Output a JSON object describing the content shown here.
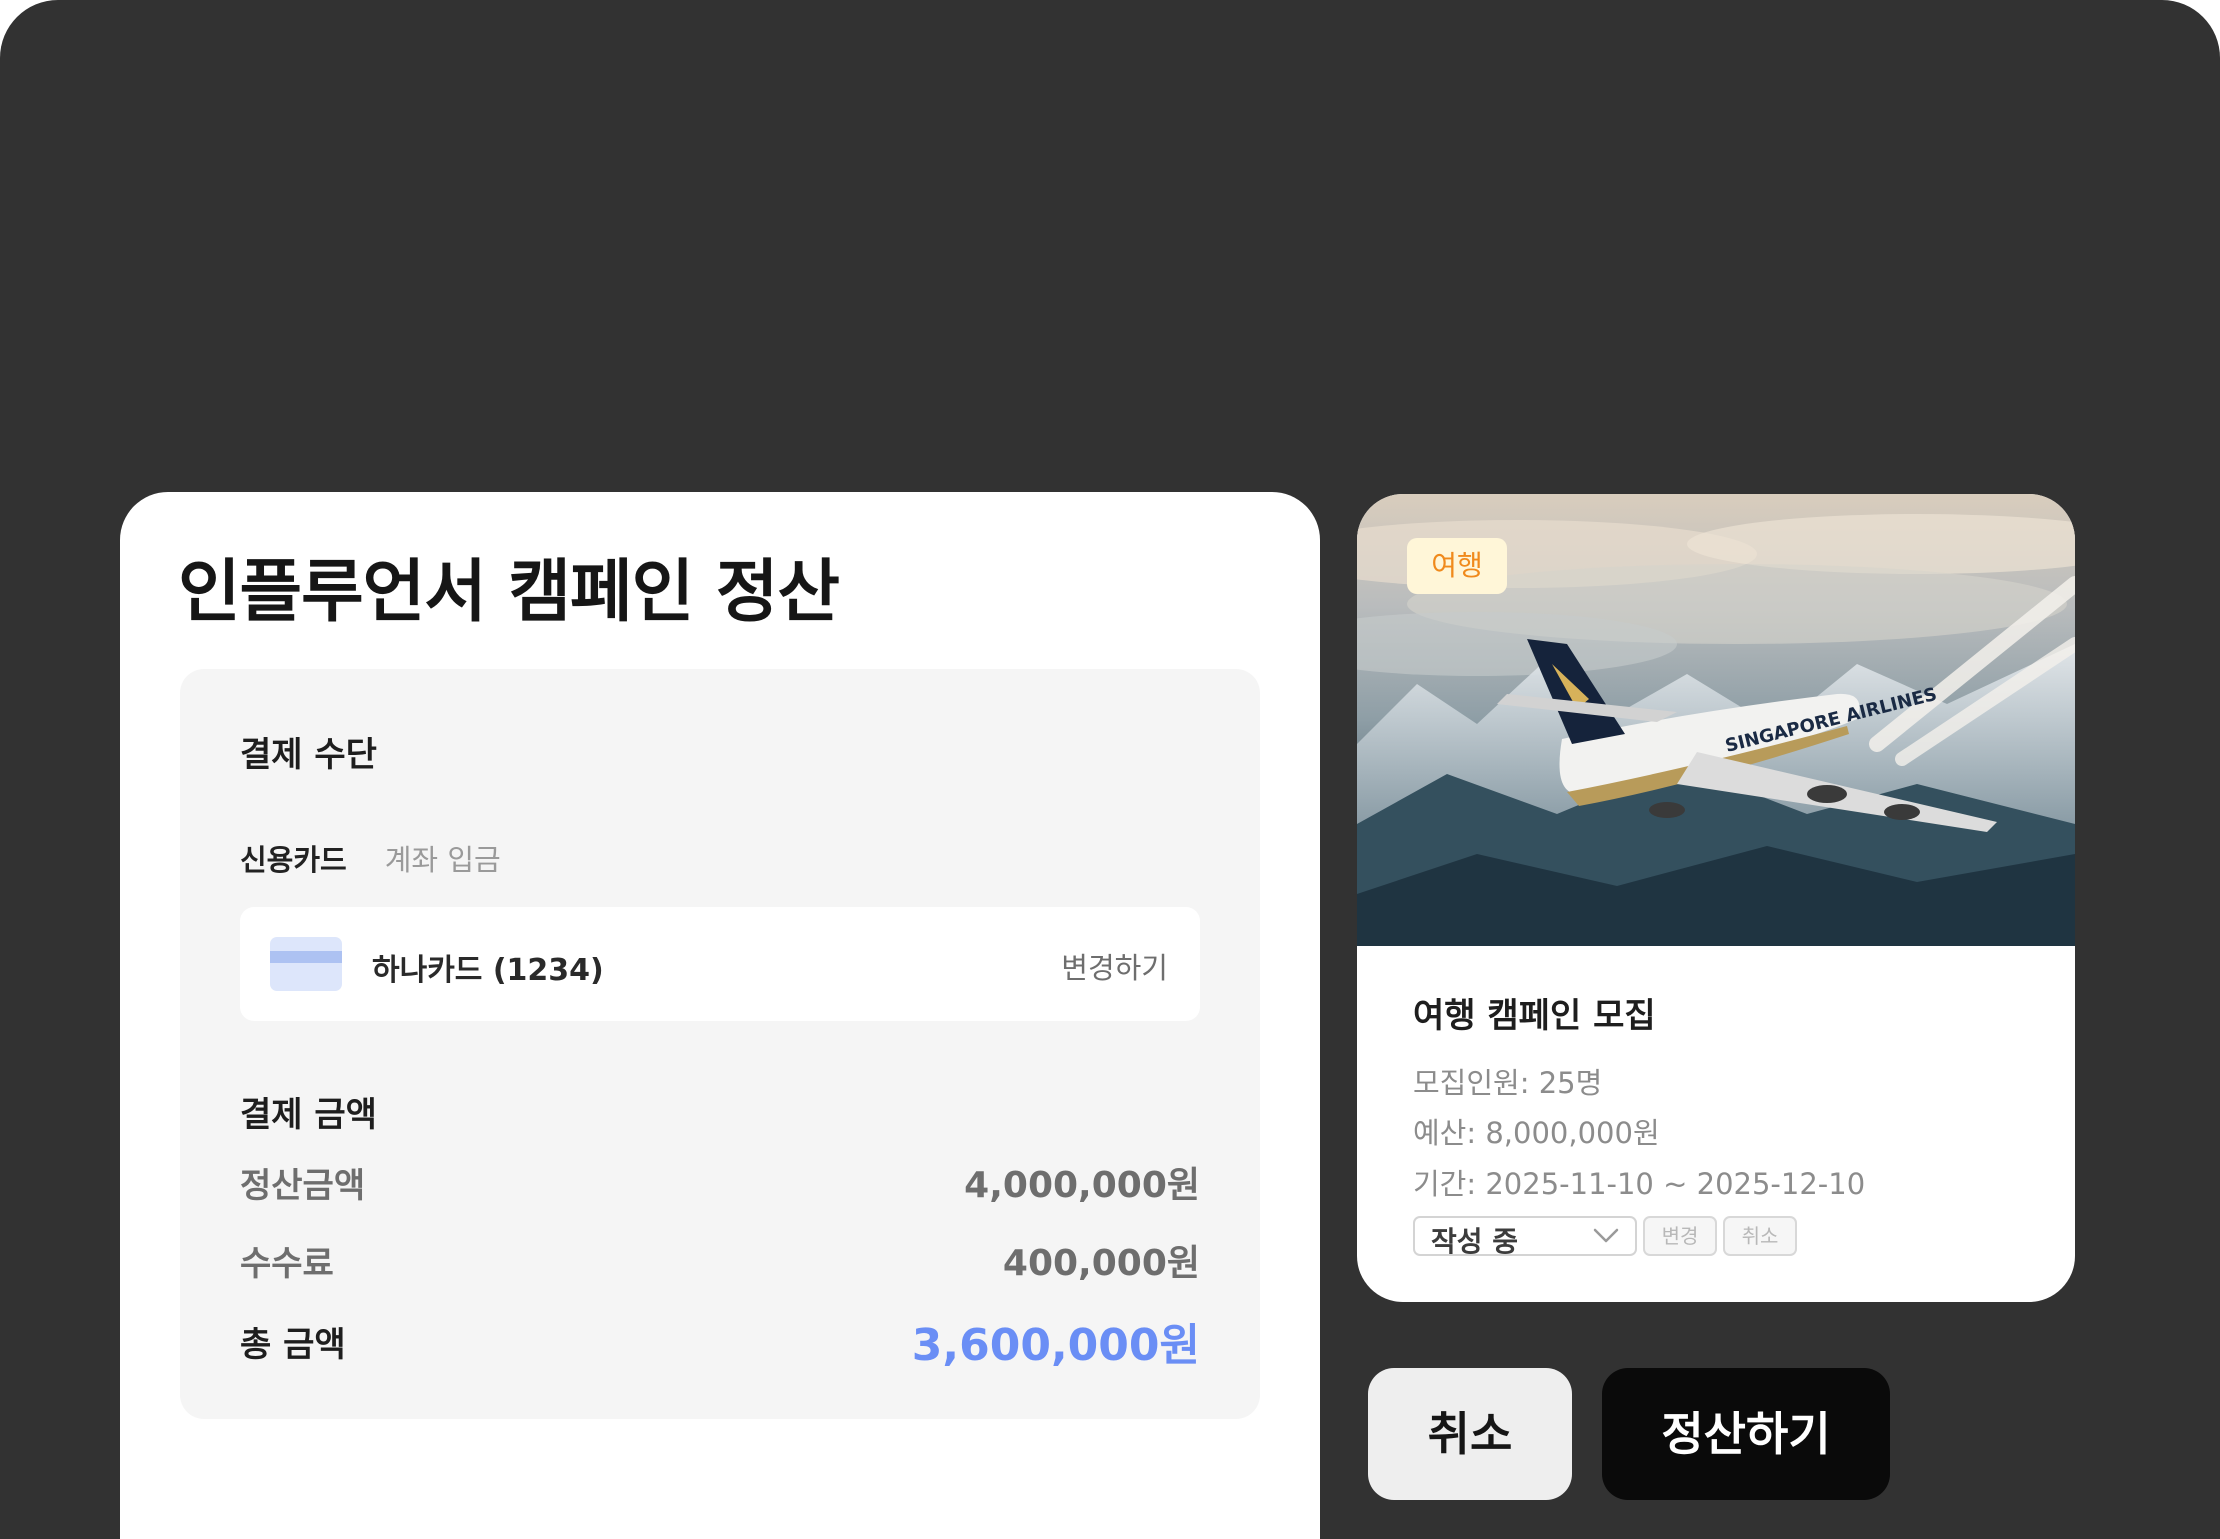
{
  "panel": {
    "title": "인플루언서 캠페인 정산",
    "payment_method": {
      "heading": "결제 수단",
      "tabs": [
        {
          "label": "신용카드",
          "active": true
        },
        {
          "label": "계좌 입금",
          "active": false
        }
      ],
      "card": {
        "name": "하나카드 (1234)",
        "change_label": "변경하기",
        "icon": "credit-card-icon"
      }
    },
    "payment_amount": {
      "heading": "결제 금액",
      "settlement": {
        "label": "정산금액",
        "value": "4,000,000원"
      },
      "fee": {
        "label": "수수료",
        "value": "400,000원"
      },
      "total": {
        "label": "총 금액",
        "value": "3,600,000원"
      }
    }
  },
  "campaign": {
    "category": "여행",
    "title": "여행 캠페인 모집",
    "recruits": "모집인원: 25명",
    "budget": "예산: 8,000,000원",
    "period": "기간: 2025-11-10 ~ 2025-12-10",
    "status": "작성 중",
    "change_label": "변경",
    "cancel_label": "취소",
    "photo_label": "SINGAPORE AIRLINES"
  },
  "actions": {
    "cancel_label": "취소",
    "confirm_label": "정산하기"
  },
  "colors": {
    "background": "#323232",
    "total_amount": "#6a8ef5",
    "category_badge_text": "#f08a1c",
    "category_badge_bg": "#fff6d8",
    "confirm_button": "#0a0a0a"
  }
}
